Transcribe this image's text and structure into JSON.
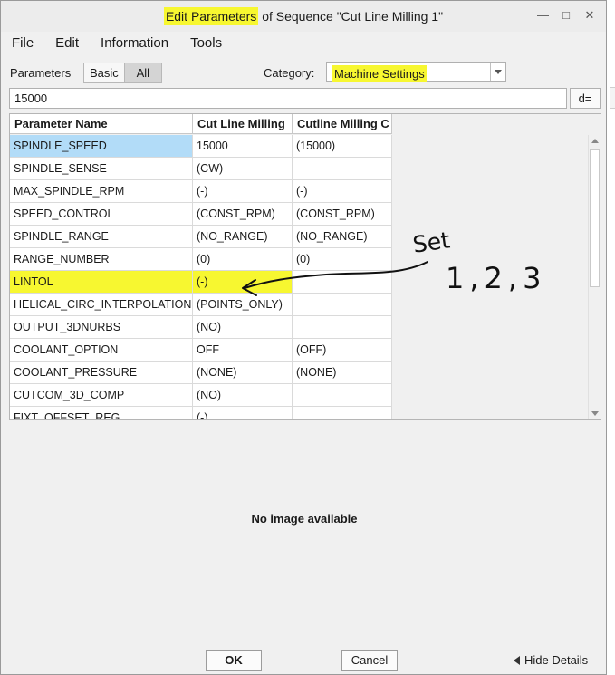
{
  "window": {
    "title_highlight": "Edit Parameters",
    "title_rest": " of Sequence \"Cut Line Milling 1\"",
    "controls": {
      "minimize": "—",
      "maximize": "□",
      "close": "✕"
    }
  },
  "menu": [
    "File",
    "Edit",
    "Information",
    "Tools"
  ],
  "toolbar": {
    "parameters_label": "Parameters",
    "basic_label": "Basic",
    "all_label": "All",
    "category_label": "Category:",
    "category_value": "Machine Settings"
  },
  "search": {
    "value": "15000",
    "button_label": "d="
  },
  "table": {
    "headers": [
      "Parameter Name",
      "Cut Line Milling",
      "Cutline Milling C"
    ],
    "rows": [
      [
        "SPINDLE_SPEED",
        "15000",
        "(15000)"
      ],
      [
        "SPINDLE_SENSE",
        "(CW)",
        ""
      ],
      [
        "MAX_SPINDLE_RPM",
        "(-)",
        "(-)"
      ],
      [
        "SPEED_CONTROL",
        "(CONST_RPM)",
        "(CONST_RPM)"
      ],
      [
        "SPINDLE_RANGE",
        "(NO_RANGE)",
        "(NO_RANGE)"
      ],
      [
        "RANGE_NUMBER",
        "(0)",
        "(0)"
      ],
      [
        "LINTOL",
        "(-)",
        ""
      ],
      [
        "HELICAL_CIRC_INTERPOLATION",
        "(POINTS_ONLY)",
        ""
      ],
      [
        "OUTPUT_3DNURBS",
        "(NO)",
        ""
      ],
      [
        "COOLANT_OPTION",
        "OFF",
        "(OFF)"
      ],
      [
        "COOLANT_PRESSURE",
        "(NONE)",
        "(NONE)"
      ],
      [
        "CUTCOM_3D_COMP",
        "(NO)",
        ""
      ],
      [
        "FIXT_OFFSET_REG",
        "(-)",
        ""
      ]
    ]
  },
  "annotation": {
    "text_set": "Set",
    "text_values": "1,2,3"
  },
  "preview": {
    "text": "No image available"
  },
  "footer": {
    "ok_label": "OK",
    "cancel_label": "Cancel",
    "hide_details_label": "Hide Details"
  }
}
